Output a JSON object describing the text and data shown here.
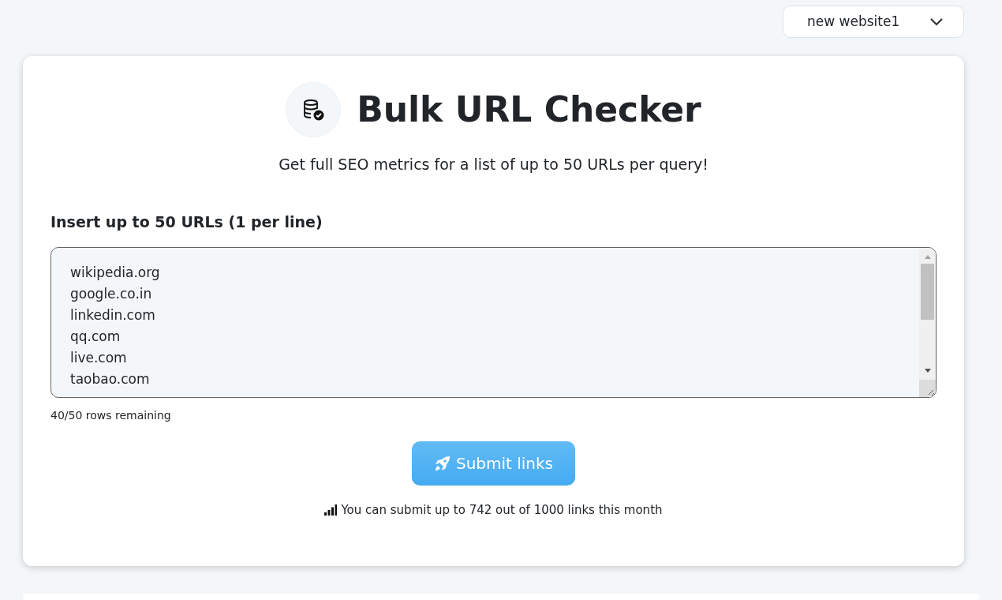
{
  "project_select": {
    "value": "new website1"
  },
  "header": {
    "title": "Bulk URL Checker",
    "subtitle": "Get full SEO metrics for a list of up to 50 URLs per query!"
  },
  "url_input": {
    "label": "Insert up to 50 URLs (1 per line)",
    "value": [
      "wikipedia.org",
      "google.co.in",
      "linkedin.com",
      "qq.com",
      "live.com",
      "taobao.com"
    ],
    "counter": "40/50 rows remaining"
  },
  "submit_button": {
    "label": "Submit links"
  },
  "quota": {
    "text": "You can submit up to 742 out of 1000 links this month"
  }
}
